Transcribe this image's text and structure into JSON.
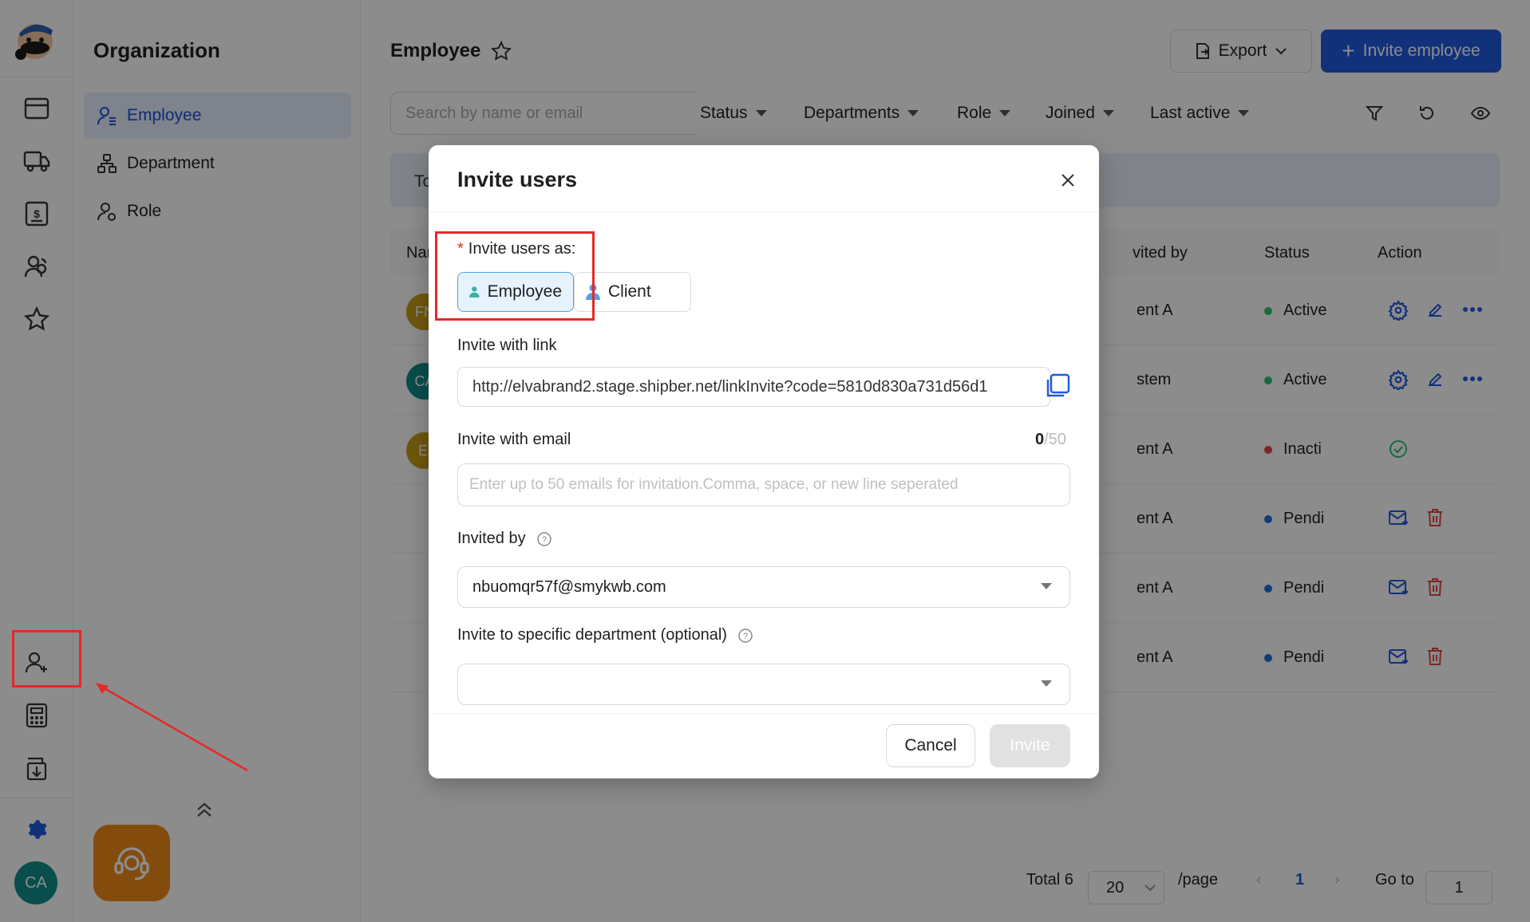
{
  "sidebar": {
    "title": "Organization",
    "items": [
      {
        "label": "Employee",
        "active": true
      },
      {
        "label": "Department",
        "active": false
      },
      {
        "label": "Role",
        "active": false
      }
    ]
  },
  "rail": {
    "icons": [
      "wallet-icon",
      "truck-icon",
      "invoice-icon",
      "users-icon",
      "star-icon",
      "user-add-icon",
      "calculator-icon",
      "download-doc-icon",
      "gear-icon"
    ],
    "user_initials": "CA"
  },
  "header": {
    "title": "Employee",
    "export_label": "Export",
    "invite_label": "Invite employee"
  },
  "search": {
    "placeholder": "Search by name or email"
  },
  "filters": [
    "Status",
    "Departments",
    "Role",
    "Joined",
    "Last active"
  ],
  "banner": {
    "text": "To"
  },
  "table": {
    "columns": [
      "Nar",
      "vited by",
      "Status",
      "Action"
    ],
    "rows": [
      {
        "initials": "FN",
        "avatar_color": "#c9a01a",
        "invited_by": "ent A",
        "status": "Active",
        "status_color": "#2fbf71"
      },
      {
        "initials": "CA",
        "avatar_color": "#0f8f8a",
        "invited_by": "stem",
        "status": "Active",
        "status_color": "#2fbf71"
      },
      {
        "initials": "El",
        "avatar_color": "#c9a01a",
        "invited_by": "ent A",
        "status": "Inacti",
        "status_color": "#e04848"
      },
      {
        "initials": "",
        "avatar_color": "",
        "invited_by": "ent A",
        "status": "Pendi",
        "status_color": "#1f6fd8"
      },
      {
        "initials": "",
        "avatar_color": "",
        "invited_by": "ent A",
        "status": "Pendi",
        "status_color": "#1f6fd8"
      },
      {
        "initials": "",
        "avatar_color": "",
        "invited_by": "ent A",
        "status": "Pendi",
        "status_color": "#1f6fd8"
      }
    ]
  },
  "pagination": {
    "total": "Total 6",
    "page_size": "20",
    "per_page": "/page",
    "current": "1",
    "goto_label": "Go to",
    "goto_value": "1"
  },
  "modal": {
    "title": "Invite users",
    "invite_as_label": "Invite users as:",
    "roles": [
      "Employee",
      "Client"
    ],
    "selected_role": "Employee",
    "link_label": "Invite with link",
    "link_value": "http://elvabrand2.stage.shipber.net/linkInvite?code=5810d830a731d56d1",
    "email_label": "Invite with email",
    "email_count": "0",
    "email_max": "/50",
    "email_placeholder": "Enter up to 50 emails for invitation.Comma, space, or new line seperated",
    "invited_by_label": "Invited by",
    "invited_by_value": "nbuomqr57f@smykwb.com",
    "department_label": "Invite to specific department (optional)",
    "department_value": "",
    "cancel_label": "Cancel",
    "submit_label": "Invite"
  }
}
